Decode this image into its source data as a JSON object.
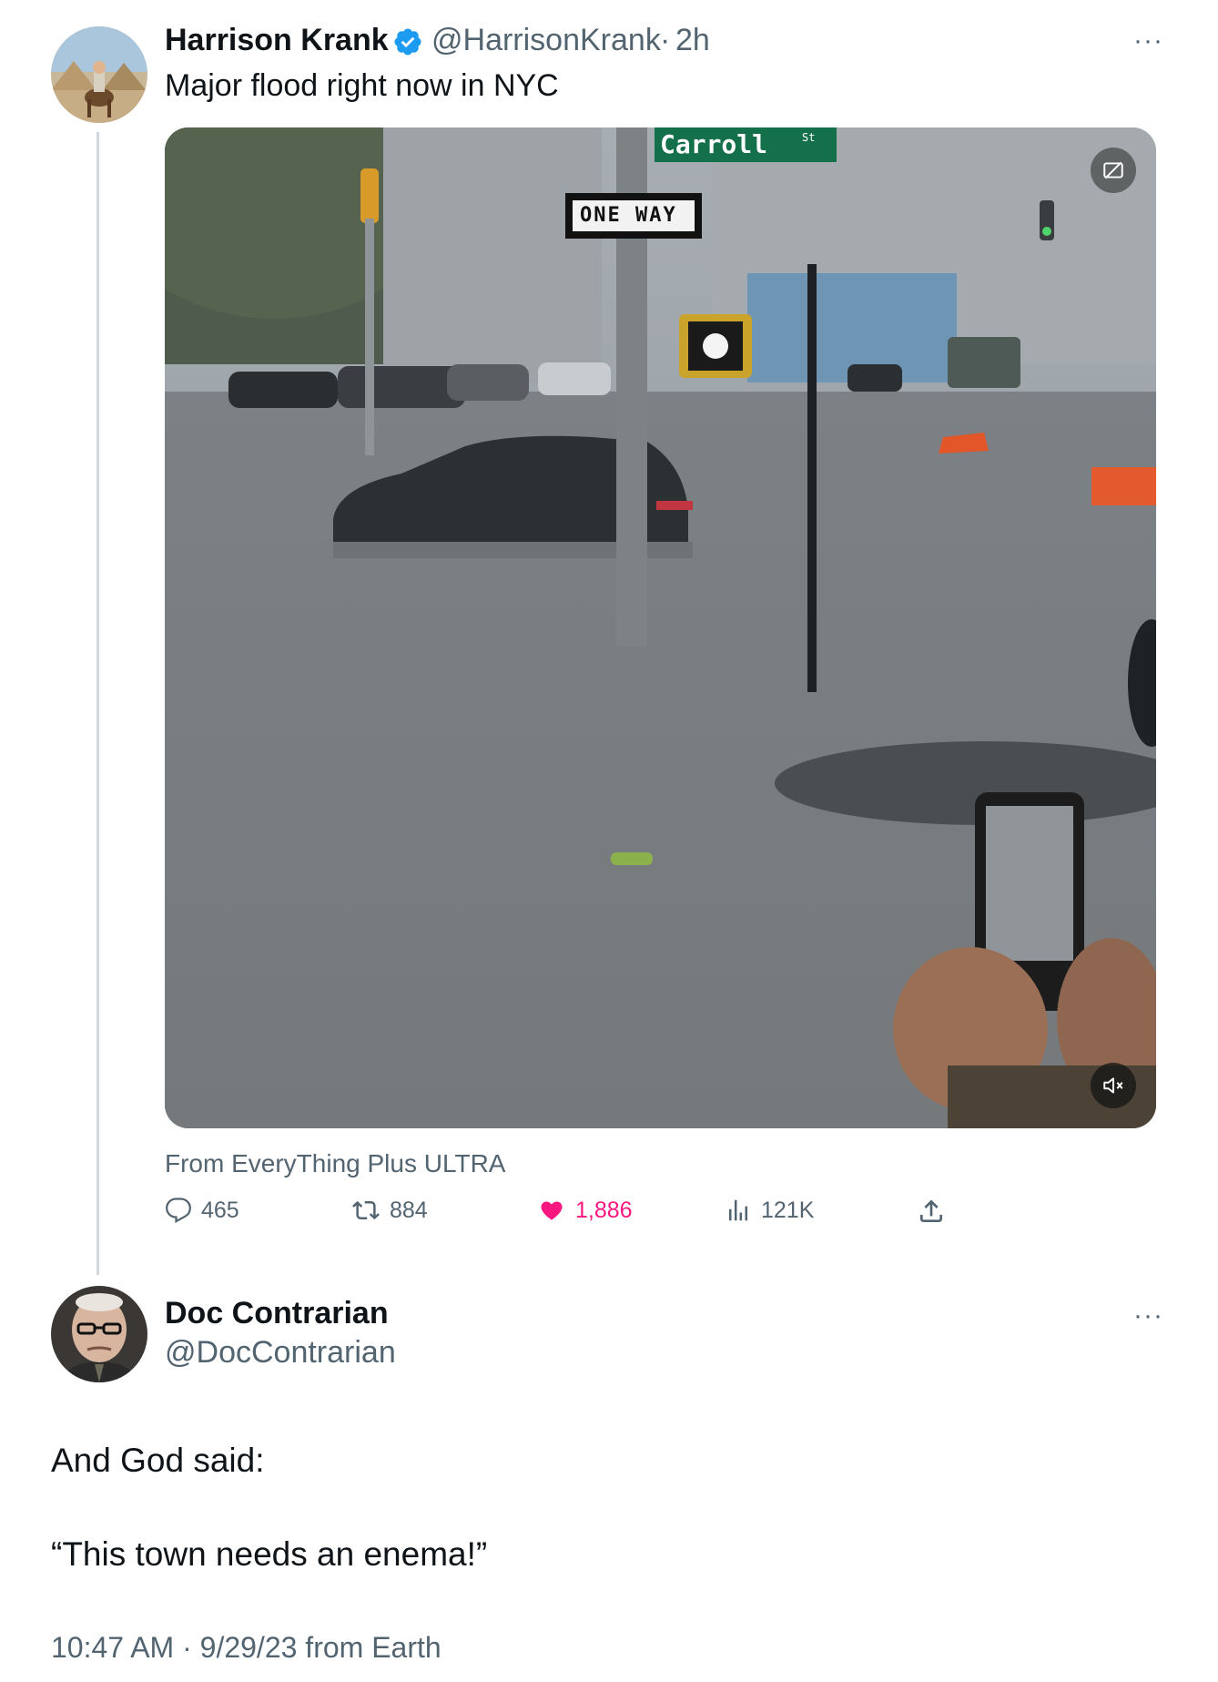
{
  "tweet": {
    "author_name": "Harrison Krank",
    "verified": true,
    "handle": "@HarrisonKrank",
    "separator": "·",
    "age": "2h",
    "text": "Major flood right now in NYC",
    "media": {
      "street_sign": "Carroll",
      "street_sign_suffix": "St",
      "one_way_sign": "ONE WAY"
    },
    "source": "From EveryThing Plus ULTRA",
    "actions": {
      "replies": "465",
      "reposts": "884",
      "likes": "1,886",
      "views": "121K"
    },
    "more_label": "···"
  },
  "reply": {
    "author_name": "Doc Contrarian",
    "handle": "@DocContrarian",
    "line1": "And God said:",
    "line2": "“This town needs an enema!”",
    "timestamp": "10:47 AM · 9/29/23 from Earth",
    "more_label": "···"
  },
  "colors": {
    "accent_blue": "#1d9bf0",
    "like_pink": "#f91880",
    "muted_text": "#536471",
    "thread_line": "#cfd9de"
  },
  "icons": [
    "reply-icon",
    "repost-icon",
    "like-icon",
    "views-icon",
    "share-icon",
    "verified-badge-icon",
    "more-icon",
    "mute-icon",
    "media-info-icon"
  ]
}
